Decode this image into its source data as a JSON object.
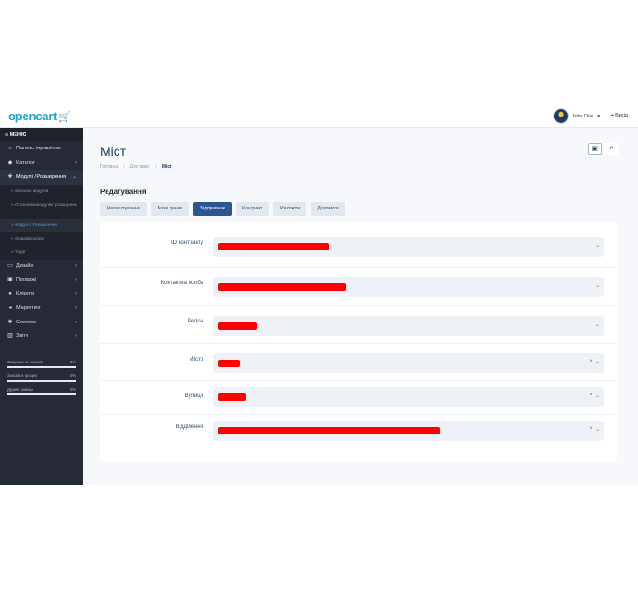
{
  "header": {
    "logo": "opencart",
    "logo_cart": "🛒",
    "user_name": "John Doe",
    "user_caret": "▾",
    "logout_label": "Вихід"
  },
  "sidebar": {
    "menu_label": "МЕНЮ",
    "items": [
      {
        "label": "Панель управління",
        "icon": "dashboard-icon",
        "glyph": "⌂"
      },
      {
        "label": "Каталог",
        "icon": "tag-icon",
        "glyph": "◆"
      },
      {
        "label": "Модулі / Розширення",
        "icon": "puzzle-icon",
        "glyph": "✚"
      },
      {
        "label": "Дизайн",
        "icon": "monitor-icon",
        "glyph": "▭"
      },
      {
        "label": "Продажі",
        "icon": "cart-icon",
        "glyph": "▣"
      },
      {
        "label": "Клієнти",
        "icon": "user-icon",
        "glyph": "●"
      },
      {
        "label": "Маркетинг",
        "icon": "share-icon",
        "glyph": "◂"
      },
      {
        "label": "Система",
        "icon": "gear-icon",
        "glyph": "✱"
      },
      {
        "label": "Звіти",
        "icon": "bar-chart-icon",
        "glyph": "▥"
      }
    ],
    "subitems": [
      "Магазин модулів",
      "Установка модулів/ розширень",
      "Модулі / Розширення",
      "Модифікатори",
      "Події"
    ],
    "stats": [
      {
        "label": "Завершених заказів",
        "value": "0%",
        "fill": 0
      },
      {
        "label": "Заказів в процесі",
        "value": "0%",
        "fill": 0
      },
      {
        "label": "Другие заказы",
        "value": "0%",
        "fill": 0
      }
    ]
  },
  "page": {
    "title": "Міст",
    "breadcrumb": [
      "Головна",
      "Доставка",
      "Міст"
    ],
    "save_glyph": "💾",
    "back_glyph": "↶",
    "section_title": "Редагування",
    "tabs": [
      "Налаштування",
      "База даних",
      "Відправник",
      "Контракт",
      "Контакти",
      "Допомога"
    ],
    "active_tab_index": 2
  },
  "form": {
    "fields": [
      {
        "label": "ID контракту",
        "control": "dropdown",
        "value_redacted": true
      },
      {
        "label": "Контактна особа",
        "control": "dropdown",
        "value_redacted": true
      },
      {
        "label": "Регіон",
        "control": "dropdown",
        "value_redacted": true
      },
      {
        "label": "Місто",
        "control": "select-clearable",
        "value_redacted": true
      },
      {
        "label": "Вулиця",
        "control": "select-clearable",
        "value_redacted": true
      },
      {
        "label": "Відділення",
        "control": "select-clearable",
        "value_redacted": true
      }
    ],
    "caret_glyph": "⌄",
    "clear_glyph": "×"
  },
  "colors": {
    "sidebar": "#252a35",
    "accent": "#2b5692",
    "title": "#1f3f66",
    "redaction": "#ff0000"
  }
}
